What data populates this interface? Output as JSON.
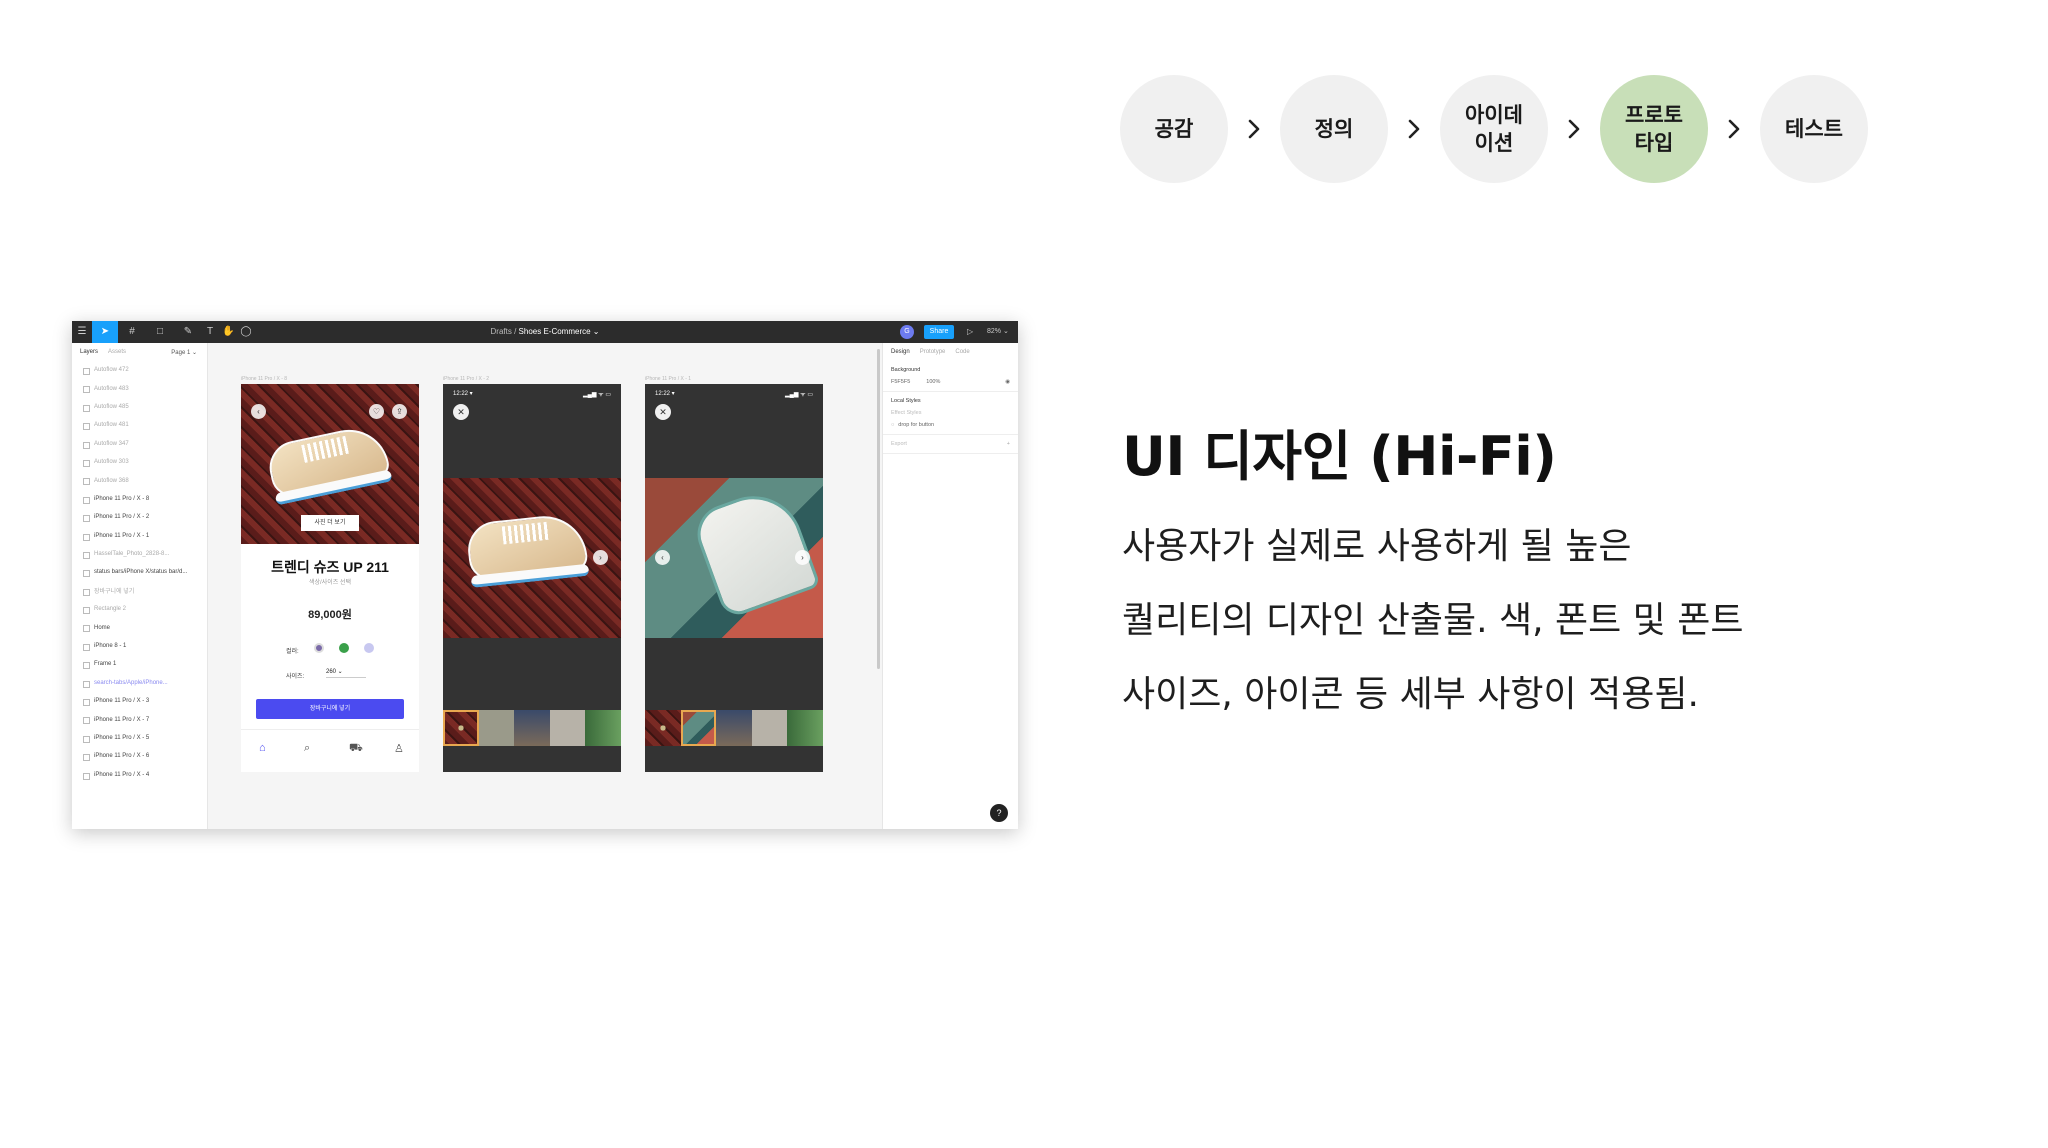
{
  "process": {
    "steps": [
      {
        "label": "공감",
        "active": false
      },
      {
        "label": "정의",
        "active": false
      },
      {
        "label": "아이데\n이션",
        "active": false
      },
      {
        "label": "프로토\n타입",
        "active": true
      },
      {
        "label": "테스트",
        "active": false
      }
    ],
    "active_color": "#c8dfb8",
    "inactive_color": "#f0f0f0"
  },
  "heading": "UI 디자인 (Hi-Fi)",
  "description": {
    "line1": "사용자가 실제로 사용하게 될 높은",
    "line2": "퀄리티의 디자인 산출물. 색, 폰트 및 폰트",
    "line3": "사이즈, 아이콘 등 세부 사항이 적용됨."
  },
  "figma": {
    "breadcrumb_prefix": "Drafts / ",
    "file_name": "Shoes E-Commerce ⌄",
    "share_label": "Share",
    "zoom": "82% ⌄",
    "avatar": "G",
    "accent": "#18a0fb",
    "left_panel": {
      "tab_layers": "Layers",
      "tab_assets": "Assets",
      "page": "Page 1 ⌄",
      "layers": [
        "Autoflow 472",
        "Autoflow 483",
        "Autoflow 485",
        "Autoflow 481",
        "Autoflow 347",
        "Autoflow 303",
        "Autoflow 368",
        "iPhone 11 Pro / X - 8",
        "iPhone 11 Pro / X - 2",
        "iPhone 11 Pro / X - 1",
        "HasselTale_Photo_2828-8...",
        "status bars/iPhone X/status bar/d...",
        "장바구니에 넣기",
        "Rectangle 2",
        "Home",
        "iPhone 8 - 1",
        "Frame 1",
        "search-tabs/Apple/iPhone...",
        "iPhone 11 Pro / X - 3",
        "iPhone 11 Pro / X - 7",
        "iPhone 11 Pro / X - 5",
        "iPhone 11 Pro / X - 6",
        "iPhone 11 Pro / X - 4"
      ]
    },
    "canvas": {
      "frame_labels": [
        "iPhone 11 Pro / X - 8",
        "iPhone 11 Pro / X - 2",
        "iPhone 11 Pro / X - 1"
      ],
      "product": {
        "photo_tag": "사진 더 보기",
        "name": "트렌디 슈즈 UP 211",
        "subtitle": "색상/사이즈 선택",
        "price": "89,000원",
        "color_label": "컬러:",
        "size_label": "사이즈:",
        "size_value": "260  ⌄",
        "cta": "장바구니에 넣기",
        "cta_color": "#4b4bf0",
        "swatches": [
          "#7a6aa8",
          "#3aa04a",
          "#c8c8f0"
        ]
      },
      "status_time": "12:22 ▾",
      "status_icons": "▂▄▆ ᯤ ▭"
    },
    "right_panel": {
      "tab_design": "Design",
      "tab_prototype": "Prototype",
      "tab_code": "Code",
      "background_label": "Background",
      "background_hex": "F5F5F5",
      "background_opacity": "100%",
      "local_styles_label": "Local Styles",
      "effect_styles": "Effect Styles",
      "drop_shadow": "drop for button",
      "export_label": "Export"
    },
    "help": "?"
  }
}
